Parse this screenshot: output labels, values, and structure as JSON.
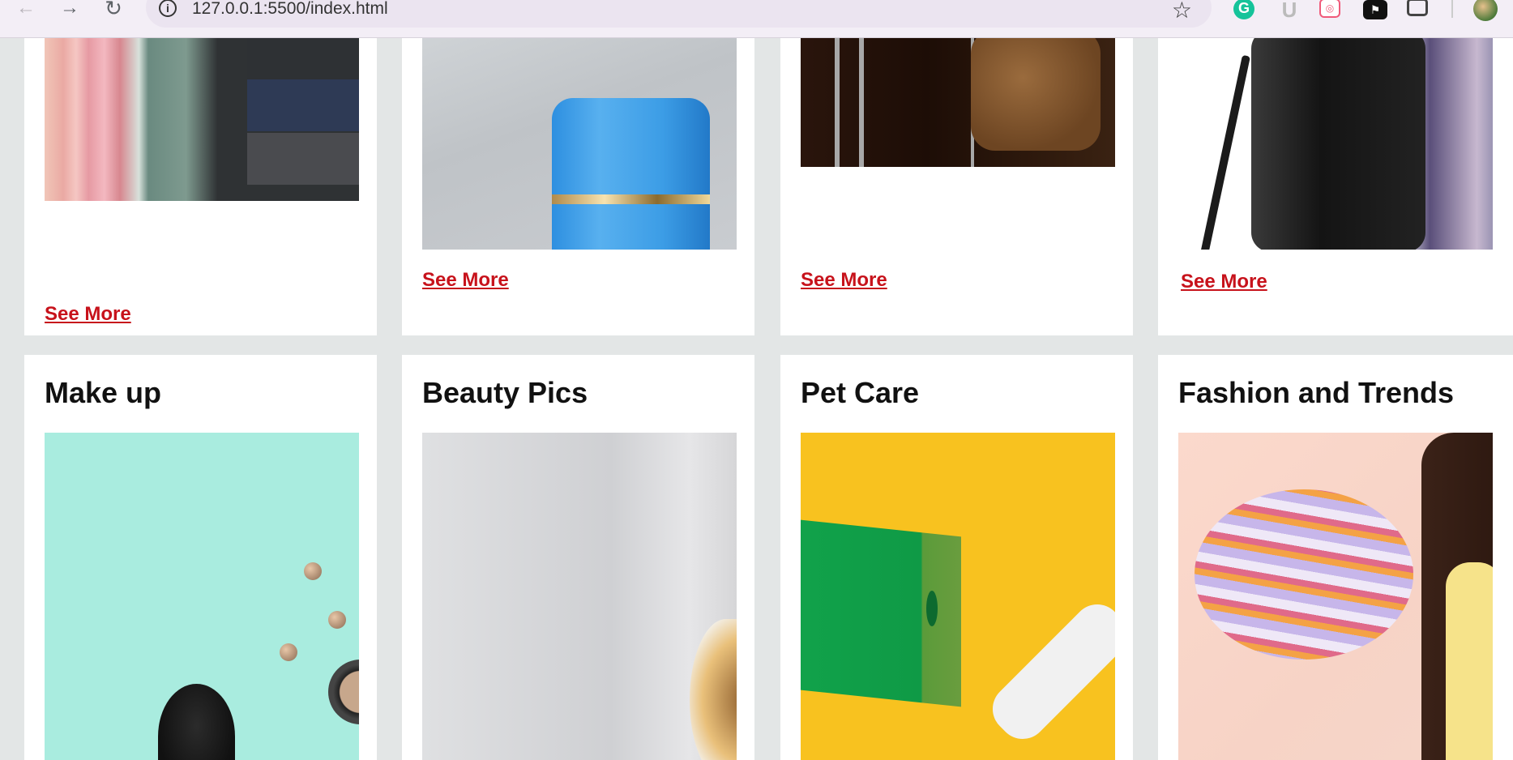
{
  "browser": {
    "url": "127.0.0.1:5500/index.html",
    "icons": [
      "back-icon",
      "forward-icon",
      "reload-icon",
      "site-info-icon",
      "bookmark-star-icon",
      "grammarly-icon",
      "extension-u-icon",
      "extension-camera-icon",
      "extension-dark-icon",
      "extensions-puzzle-icon",
      "profile-avatar"
    ]
  },
  "cards_top": [
    {
      "see_more": "See More"
    },
    {
      "see_more": "See More"
    },
    {
      "see_more": "See More"
    },
    {
      "see_more": "See More"
    }
  ],
  "cards_bottom": [
    {
      "title": "Make up"
    },
    {
      "title": "Beauty Pics"
    },
    {
      "title": "Pet Care"
    },
    {
      "title": "Fashion and Trends"
    }
  ],
  "colors": {
    "page_background": "#e3e6e6",
    "link_red": "#c7121b"
  }
}
